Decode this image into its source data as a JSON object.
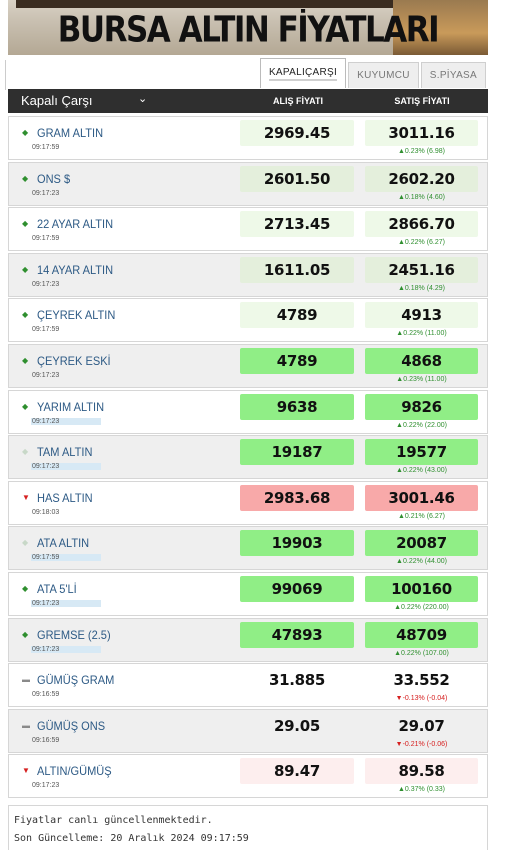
{
  "banner": {
    "title": "BURSA ALTIN FİYATLARI"
  },
  "tabs": [
    {
      "label": "KAPALIÇARŞI",
      "active": true
    },
    {
      "label": "KUYUMCU",
      "active": false
    },
    {
      "label": "S.PİYASA",
      "active": false
    }
  ],
  "header": {
    "market_select": "Kapalı Çarşı",
    "buy_label": "ALIŞ FİYATI",
    "sell_label": "SATIŞ FİYATI"
  },
  "rows": [
    {
      "name": "GRAM ALTIN",
      "time": "09:17:59",
      "trend": "up",
      "buy": "2969.45",
      "sell": "3011.16",
      "change": "▲0.23% (6.98)",
      "change_dir": "up",
      "buy_bg": "light",
      "sell_bg": "light",
      "time_hl": false
    },
    {
      "name": "ONS $",
      "time": "09:17:23",
      "trend": "up",
      "buy": "2601.50",
      "sell": "2602.20",
      "change": "▲0.18% (4.60)",
      "change_dir": "up",
      "buy_bg": "pale",
      "sell_bg": "pale",
      "time_hl": false
    },
    {
      "name": "22 AYAR ALTIN",
      "time": "09:17:59",
      "trend": "up",
      "buy": "2713.45",
      "sell": "2866.70",
      "change": "▲0.22% (6.27)",
      "change_dir": "up",
      "buy_bg": "light",
      "sell_bg": "light",
      "time_hl": false
    },
    {
      "name": "14 AYAR ALTIN",
      "time": "09:17:23",
      "trend": "up",
      "buy": "1611.05",
      "sell": "2451.16",
      "change": "▲0.18% (4.29)",
      "change_dir": "up",
      "buy_bg": "pale",
      "sell_bg": "pale",
      "time_hl": false
    },
    {
      "name": "ÇEYREK ALTIN",
      "time": "09:17:59",
      "trend": "up",
      "buy": "4789",
      "sell": "4913",
      "change": "▲0.22% (11.00)",
      "change_dir": "up",
      "buy_bg": "light",
      "sell_bg": "light",
      "time_hl": false
    },
    {
      "name": "ÇEYREK ESKİ",
      "time": "09:17:23",
      "trend": "up",
      "buy": "4789",
      "sell": "4868",
      "change": "▲0.23% (11.00)",
      "change_dir": "up",
      "buy_bg": "green",
      "sell_bg": "green",
      "time_hl": false
    },
    {
      "name": "YARIM ALTIN",
      "time": "09:17:23",
      "trend": "up",
      "buy": "9638",
      "sell": "9826",
      "change": "▲0.22% (22.00)",
      "change_dir": "up",
      "buy_bg": "green",
      "sell_bg": "green",
      "time_hl": true
    },
    {
      "name": "TAM ALTIN",
      "time": "09:17:23",
      "trend": "faint",
      "buy": "19187",
      "sell": "19577",
      "change": "▲0.22% (43.00)",
      "change_dir": "up",
      "buy_bg": "green",
      "sell_bg": "green",
      "time_hl": true
    },
    {
      "name": "HAS ALTIN",
      "time": "09:18:03",
      "trend": "down",
      "buy": "2983.68",
      "sell": "3001.46",
      "change": "▲0.21% (6.27)",
      "change_dir": "up",
      "buy_bg": "red",
      "sell_bg": "red",
      "time_hl": false
    },
    {
      "name": "ATA ALTIN",
      "time": "09:17:59",
      "trend": "faint",
      "buy": "19903",
      "sell": "20087",
      "change": "▲0.22% (44.00)",
      "change_dir": "up",
      "buy_bg": "green",
      "sell_bg": "green",
      "time_hl": true
    },
    {
      "name": "ATA 5'Lİ",
      "time": "09:17:23",
      "trend": "up",
      "buy": "99069",
      "sell": "100160",
      "change": "▲0.22% (220.00)",
      "change_dir": "up",
      "buy_bg": "green",
      "sell_bg": "green",
      "time_hl": true
    },
    {
      "name": "GREMSE (2.5)",
      "time": "09:17:23",
      "trend": "up",
      "buy": "47893",
      "sell": "48709",
      "change": "▲0.22% (107.00)",
      "change_dir": "up",
      "buy_bg": "green",
      "sell_bg": "green",
      "time_hl": true
    },
    {
      "name": "GÜMÜŞ GRAM",
      "time": "09:16:59",
      "trend": "neutral",
      "buy": "31.885",
      "sell": "33.552",
      "change": "▼-0.13% (-0.04)",
      "change_dir": "down",
      "buy_bg": "none",
      "sell_bg": "none",
      "time_hl": false
    },
    {
      "name": "GÜMÜŞ ONS",
      "time": "09:16:59",
      "trend": "neutral",
      "buy": "29.05",
      "sell": "29.07",
      "change": "▼-0.21% (-0.06)",
      "change_dir": "down",
      "buy_bg": "none",
      "sell_bg": "none",
      "time_hl": false
    },
    {
      "name": "ALTIN/GÜMÜŞ",
      "time": "09:17:23",
      "trend": "down",
      "buy": "89.47",
      "sell": "89.58",
      "change": "▲0.37% (0.33)",
      "change_dir": "up",
      "buy_bg": "pink",
      "sell_bg": "pink",
      "time_hl": false
    }
  ],
  "footer": {
    "status": "Fiyatlar canlı güncellenmektedir.",
    "last_update": "Son Güncelleme: 20 Aralık 2024 09:17:59"
  },
  "colors": {
    "up": "#2f8f2f",
    "down": "#d62020",
    "header_bg": "#2f2f2f",
    "link": "#2d5a85"
  }
}
